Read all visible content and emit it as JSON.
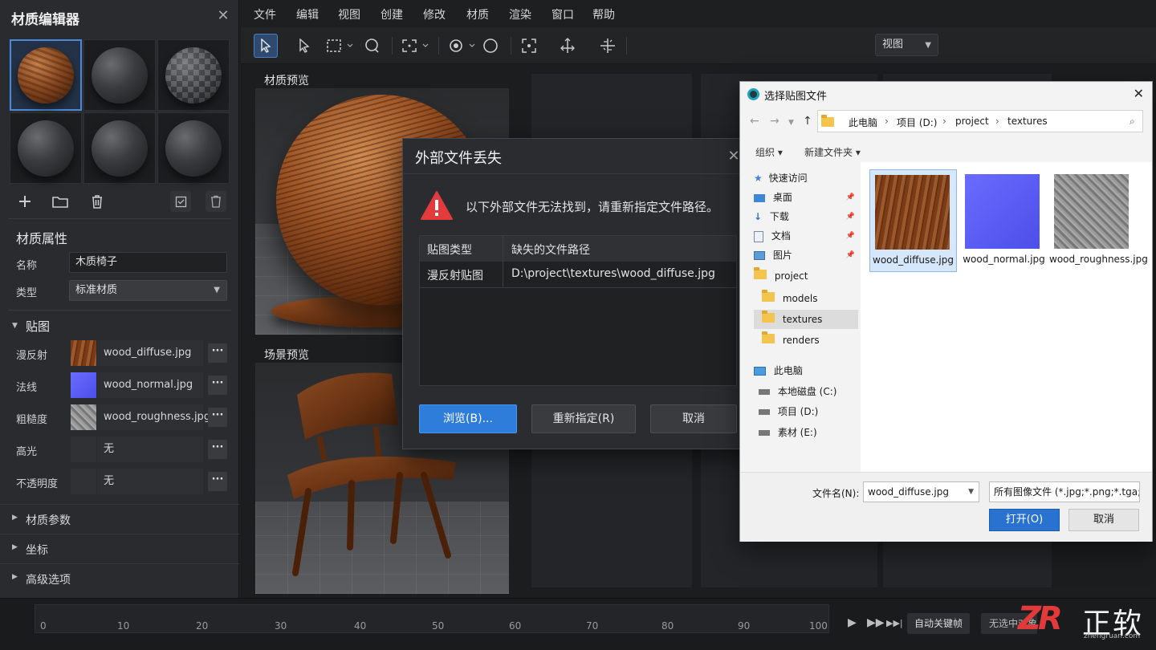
{
  "panel": {
    "title": "材质编辑器",
    "props_title": "材质属性",
    "name_label": "名称",
    "name_value": "木质椅子",
    "type_label": "类型",
    "type_value": "标准材质",
    "maps_title": "贴图",
    "maps": [
      {
        "label": "漫反射",
        "file": "wood_diffuse.jpg",
        "swatch": "wood"
      },
      {
        "label": "法线",
        "file": "wood_normal.jpg",
        "swatch": "normal"
      },
      {
        "label": "粗糙度",
        "file": "wood_roughness.jpg",
        "swatch": "rough"
      },
      {
        "label": "高光",
        "file": "无",
        "swatch": "none"
      },
      {
        "label": "不透明度",
        "file": "无",
        "swatch": "none"
      }
    ],
    "more_label": "···",
    "collapsed": [
      "材质参数",
      "坐标",
      "高级选项"
    ]
  },
  "menu": [
    "文件",
    "编辑",
    "视图",
    "创建",
    "修改",
    "材质",
    "渲染",
    "窗口",
    "帮助"
  ],
  "toolbar": {
    "view_select": "视图"
  },
  "viewports": {
    "material_preview": "材质预览",
    "scene_preview": "场景预览"
  },
  "timeline": {
    "ticks": [
      "0",
      "10",
      "20",
      "30",
      "40",
      "50",
      "60",
      "70",
      "80",
      "90",
      "100"
    ],
    "autokey": "自动关键帧",
    "selection_filter": "无选中对象"
  },
  "brand": {
    "logo": "ZR",
    "name": "正软",
    "url": "zhengruan.com"
  },
  "missing_dialog": {
    "title": "外部文件丢失",
    "message": "以下外部文件无法找到，请重新指定文件路径。",
    "col_type": "贴图类型",
    "col_path": "缺失的文件路径",
    "row_type": "漫反射贴图",
    "row_path": "D:\\project\\textures\\wood_diffuse.jpg",
    "browse": "浏览(B)...",
    "respecify": "重新指定(R)",
    "cancel": "取消"
  },
  "picker": {
    "title": "选择贴图文件",
    "path": [
      "此电脑",
      "项目 (D:)",
      "project",
      "textures"
    ],
    "cmd_organize": "组织 ▾",
    "cmd_newfolder": "新建文件夹 ▾",
    "quick_access": "快速访问",
    "quick": [
      "桌面",
      "下载",
      "文档",
      "图片"
    ],
    "project": "project",
    "folders": [
      "models",
      "textures",
      "renders"
    ],
    "this_pc": "此电脑",
    "drives": [
      "本地磁盘 (C:)",
      "项目 (D:)",
      "素材 (E:)"
    ],
    "files": [
      "wood_diffuse.jpg",
      "wood_normal.jpg",
      "wood_roughness.jpg"
    ],
    "filename_label": "文件名(N):",
    "filename_value": "wood_diffuse.jpg",
    "filetype": "所有图像文件 (*.jpg;*.png;*.tga;",
    "open": "打开(O)",
    "cancel": "取消"
  }
}
